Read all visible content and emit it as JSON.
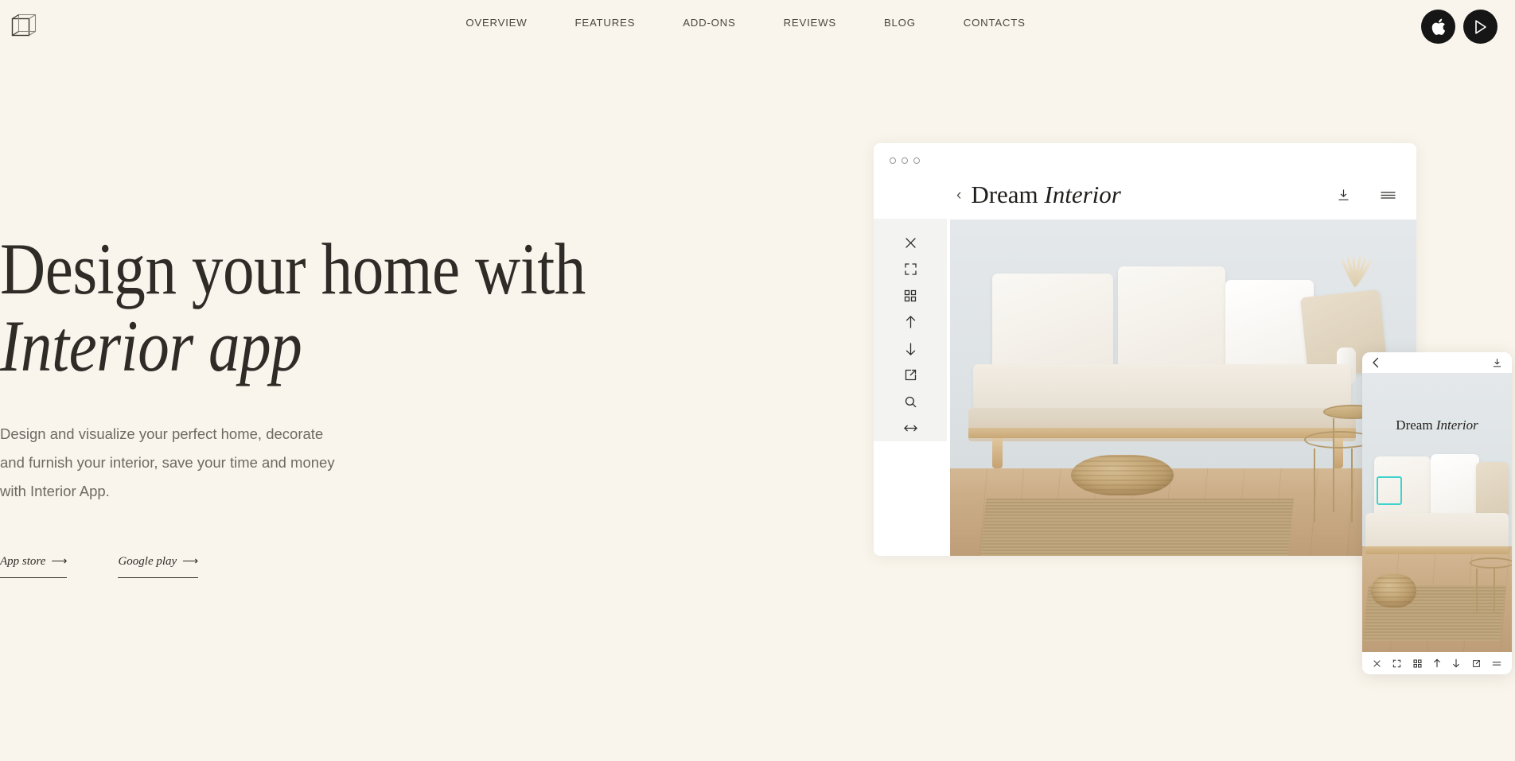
{
  "brand": {
    "logo_icon": "wireframe-cube-icon"
  },
  "nav": {
    "items": [
      {
        "label": "OVERVIEW"
      },
      {
        "label": "FEATURES"
      },
      {
        "label": "ADD-ONS"
      },
      {
        "label": "REVIEWS"
      },
      {
        "label": "BLOG"
      },
      {
        "label": "CONTACTS"
      }
    ]
  },
  "store_badges": [
    {
      "name": "apple-app-store-badge",
      "icon": "apple-icon"
    },
    {
      "name": "google-play-badge",
      "icon": "play-triangle-icon"
    }
  ],
  "hero": {
    "title_part1": "Design your home with ",
    "title_emphasis": "Interior app",
    "subtitle": "Design and visualize your perfect home, decorate and furnish your interior, save your time and money with Interior App.",
    "links": [
      {
        "label": "App store",
        "arrow": "⟶"
      },
      {
        "label": "Google play",
        "arrow": "⟶"
      }
    ]
  },
  "browser_mock": {
    "window_dots": 3,
    "title_part1": "Dream ",
    "title_emphasis": "Interior",
    "back_icon": "chevron-left-icon",
    "top_actions": [
      {
        "name": "download-icon"
      },
      {
        "name": "hamburger-menu-icon"
      }
    ],
    "sidebar_tools": [
      {
        "name": "close-icon"
      },
      {
        "name": "fullscreen-icon"
      },
      {
        "name": "grid-icon"
      },
      {
        "name": "arrow-up-icon"
      },
      {
        "name": "arrow-down-icon"
      },
      {
        "name": "external-link-icon"
      },
      {
        "name": "search-icon"
      },
      {
        "name": "arrows-horizontal-icon"
      }
    ],
    "photo_alt": "Minimal living room with white sofa, cushions, jute pouf and woven rug"
  },
  "phone_mock": {
    "title_part1": "Dream ",
    "title_emphasis": "Interior",
    "back_icon": "chevron-left-icon",
    "download_icon": "download-icon",
    "selection_color": "#3FD3CE",
    "bottom_tools": [
      {
        "name": "close-icon"
      },
      {
        "name": "fullscreen-icon"
      },
      {
        "name": "grid-icon"
      },
      {
        "name": "arrow-up-icon"
      },
      {
        "name": "arrow-down-icon"
      },
      {
        "name": "external-link-icon"
      },
      {
        "name": "menu-lines-icon"
      }
    ]
  },
  "theme": {
    "background": "#F9F5EC",
    "text": "#2F2C28",
    "muted_text": "#6E6A63",
    "badge_background": "#161616",
    "accent": "#3FD3CE"
  }
}
